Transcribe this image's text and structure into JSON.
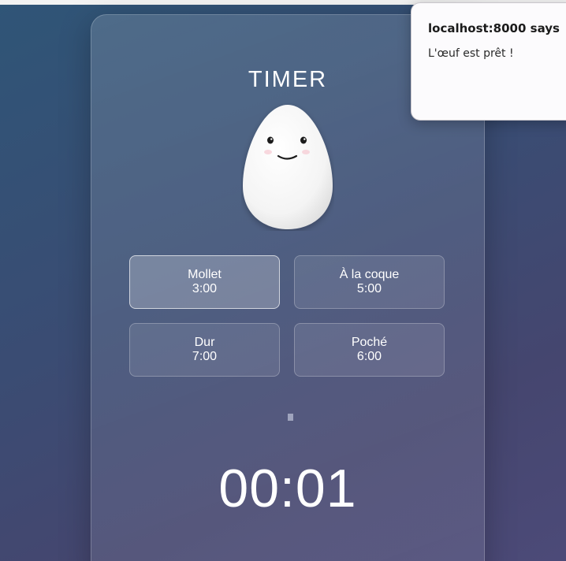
{
  "timer": {
    "title": "TIMER",
    "presets": [
      {
        "label": "Mollet",
        "time": "3:00",
        "active": true
      },
      {
        "label": "À la coque",
        "time": "5:00",
        "active": false
      },
      {
        "label": "Dur",
        "time": "7:00",
        "active": false
      },
      {
        "label": "Poché",
        "time": "6:00",
        "active": false
      }
    ],
    "display": "00:01"
  },
  "alert": {
    "title": "localhost:8000 says",
    "message": "L'œuf est prêt !"
  },
  "colors": {
    "background_start": "#2f5577",
    "background_end": "#4c4a78",
    "text": "#ffffff",
    "alert_background": "#fcfbfd"
  },
  "icons": {
    "egg": "egg-character-icon"
  }
}
